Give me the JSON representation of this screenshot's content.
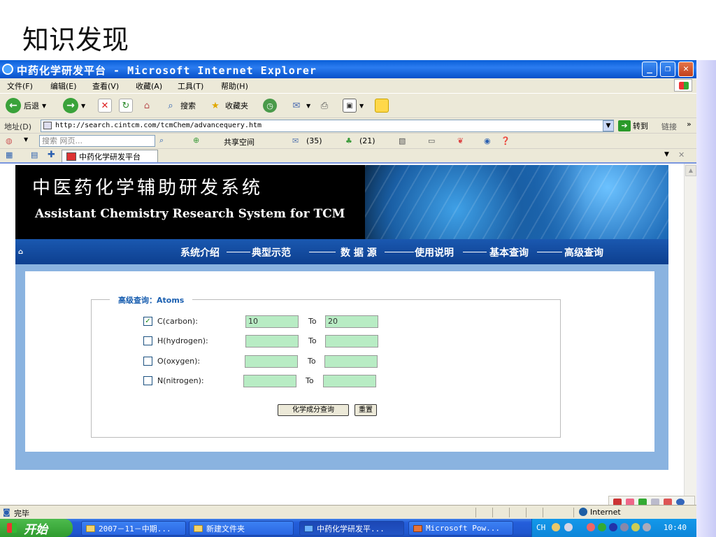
{
  "slide": {
    "title": "知识发现"
  },
  "window": {
    "title": "中药化学研发平台 - Microsoft Internet Explorer",
    "minimize": "_",
    "maximize": "❐",
    "close": "✕"
  },
  "menu": [
    "文件(F)",
    "编辑(E)",
    "查看(V)",
    "收藏(A)",
    "工具(T)",
    "帮助(H)"
  ],
  "toolbar": {
    "back": "后退",
    "search": "搜索",
    "favorites": "收藏夹"
  },
  "address": {
    "label": "地址(D)",
    "url": "http://search.cintcm.com/tcmChem/advancequery.htm",
    "go": "转到",
    "links": "链接"
  },
  "linkbar": {
    "search_placeholder": "搜索 网页...",
    "share": "共享空间",
    "mail_count": "(35)",
    "contacts_count": "(21)"
  },
  "tab": {
    "label": "中药化学研发平台"
  },
  "banner": {
    "title_cn": "中医药化学辅助研发系统",
    "title_en": "Assistant Chemistry Research System for TCM"
  },
  "nav": [
    "系统介绍",
    "典型示范",
    "数 据 源",
    "使用说明",
    "基本查询",
    "高级查询"
  ],
  "form": {
    "legend": "高级查询：Atoms",
    "rows": [
      {
        "label": "C(carbon):",
        "checked": "✓",
        "from": "10",
        "to_label": "To",
        "to": "20"
      },
      {
        "label": "H(hydrogen):",
        "checked": "",
        "from": "",
        "to_label": "To",
        "to": ""
      },
      {
        "label": "O(oxygen):",
        "checked": "",
        "from": "",
        "to_label": "To",
        "to": ""
      },
      {
        "label": "N(nitrogen):",
        "checked": "",
        "from": "",
        "to_label": "To",
        "to": ""
      }
    ],
    "query_button": "化学成分查询",
    "reset_button": "重置"
  },
  "status": {
    "text": "完毕",
    "zone": "Internet"
  },
  "taskbar": {
    "start": "开始",
    "items": [
      "2007－11－中期...",
      "新建文件夹",
      "中药化学研发平...",
      "Microsoft Pow..."
    ],
    "lang": "CH",
    "clock": "10:40"
  }
}
